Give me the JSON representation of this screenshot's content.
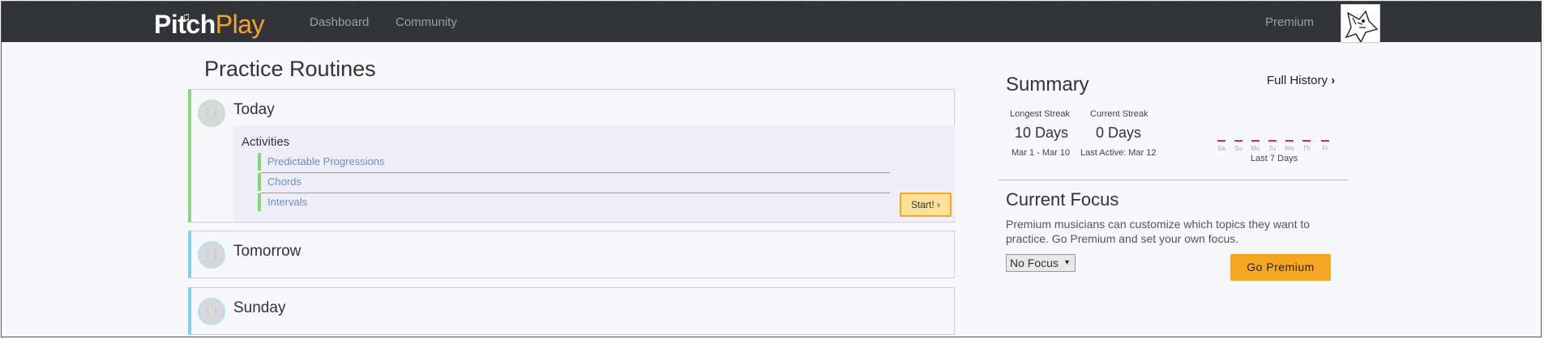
{
  "nav": {
    "logo_pitch": "Pitch",
    "logo_play": "Play",
    "links": [
      "Dashboard",
      "Community"
    ],
    "premium": "Premium"
  },
  "page_title": "Practice Routines",
  "routines": [
    {
      "title": "Today",
      "activities_title": "Activities",
      "activities": [
        "Predictable Progressions",
        "Chords",
        "Intervals"
      ],
      "start_label": "Start!"
    },
    {
      "title": "Tomorrow"
    },
    {
      "title": "Sunday"
    }
  ],
  "summary": {
    "title": "Summary",
    "full_history": "Full History",
    "longest_label": "Longest Streak",
    "longest_value": "10 Days",
    "longest_sub": "Mar 1 - Mar 10",
    "current_label": "Current Streak",
    "current_value": "0 Days",
    "current_sub": "Last Active: Mar 12",
    "days": [
      "Sa",
      "Su",
      "Mo",
      "Tu",
      "We",
      "Th",
      "Fr"
    ],
    "last7_label": "Last 7 Days"
  },
  "focus": {
    "title": "Current Focus",
    "description": "Premium musicians can customize which topics they want to practice. Go Premium and set your own focus.",
    "select_value": "No Focus",
    "button": "Go Premium"
  },
  "colors": {
    "topbar": "#2f3338",
    "accent": "#f5a623",
    "active_border": "#86d67a",
    "inactive_border": "#7dd3ef",
    "streak_dash": "#d9333a"
  }
}
